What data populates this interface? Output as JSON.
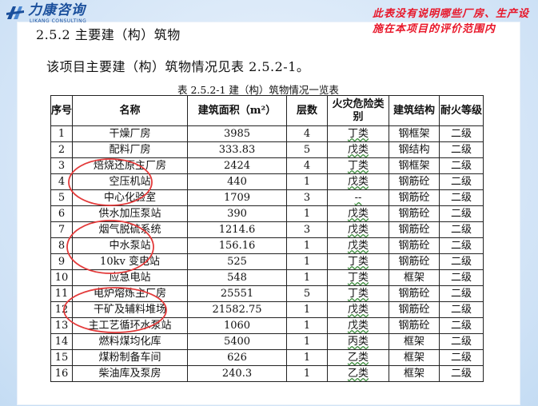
{
  "logo": {
    "cn": "力康咨询",
    "en": "LIKANG CONSULTING"
  },
  "note": "此表没有说明哪些厂房、生产设施在本项目的评价范围内",
  "heading": "2.5.2 主要建（构）筑物",
  "intro": "该项目主要建（构）筑物情况见表 2.5.2-1。",
  "caption": "表 2.5.2-1  建（构）筑物情况一览表",
  "table": {
    "headers": [
      "序号",
      "名称",
      "建筑面积（m²）",
      "层数",
      "火灾危险类别",
      "建筑结构",
      "耐火等级"
    ],
    "rows": [
      [
        "1",
        "干燥厂房",
        "3985",
        "4",
        "丁类",
        "钢框架",
        "二级"
      ],
      [
        "2",
        "配料厂房",
        "333.83",
        "5",
        "戊类",
        "钢结构",
        "二级"
      ],
      [
        "3",
        "焙烧还原主厂房",
        "2424",
        "4",
        "丁类",
        "钢框架",
        "二级"
      ],
      [
        "4",
        "空压机站",
        "440",
        "1",
        "戊类",
        "钢筋砼",
        "二级"
      ],
      [
        "5",
        "中心化验室",
        "1709",
        "3",
        "--",
        "钢筋砼",
        "二级"
      ],
      [
        "6",
        "供水加压泵站",
        "390",
        "1",
        "戊类",
        "钢筋砼",
        "二级"
      ],
      [
        "7",
        "烟气脱硫系统",
        "1214.6",
        "3",
        "戊类",
        "钢筋砼",
        "二级"
      ],
      [
        "8",
        "中水泵站",
        "156.16",
        "1",
        "戊类",
        "钢筋砼",
        "二级"
      ],
      [
        "9",
        "10kv 变电站",
        "525",
        "1",
        "丁类",
        "钢筋砼",
        "二级"
      ],
      [
        "10",
        "应急电站",
        "548",
        "1",
        "丁类",
        "框架",
        "二级"
      ],
      [
        "11",
        "电炉熔炼主厂房",
        "25551",
        "5",
        "丁类",
        "钢筋砼",
        "二级"
      ],
      [
        "12",
        "干矿及辅料堆场",
        "21582.75",
        "1",
        "戊类",
        "钢筋砼",
        "二级"
      ],
      [
        "13",
        "主工艺循环水泵站",
        "1060",
        "1",
        "戊类",
        "钢筋砼",
        "二级"
      ],
      [
        "14",
        "燃料煤均化库",
        "5400",
        "1",
        "丙类",
        "框架",
        "二级"
      ],
      [
        "15",
        "煤粉制备车间",
        "626",
        "1",
        "乙类",
        "框架",
        "二级"
      ],
      [
        "16",
        "柴油库及泵房",
        "240.3",
        "1",
        "乙类",
        "框架",
        "二级"
      ]
    ]
  },
  "colors": {
    "logo": "#1a4f9c",
    "note": "#e8172a",
    "circle": "#e33a3a"
  }
}
